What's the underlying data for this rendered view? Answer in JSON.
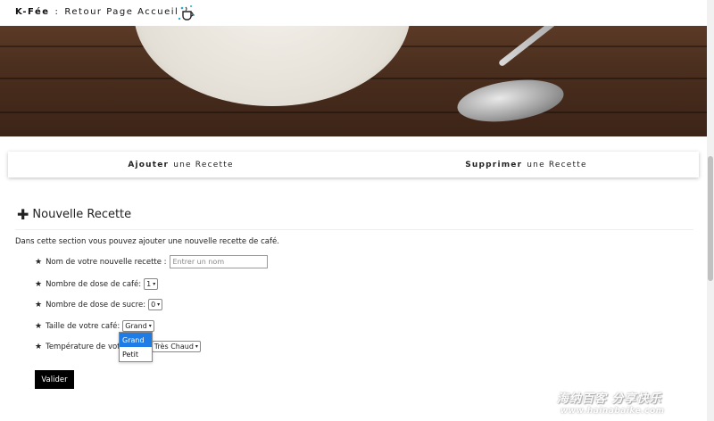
{
  "header": {
    "brand": "K-Fée",
    "separator": ":",
    "home_link": "Retour Page Accueil",
    "logo_icon": "coffee-cup-logo-icon"
  },
  "tabs": [
    {
      "bold": "Ajouter",
      "rest": "une Recette"
    },
    {
      "bold": "Supprimer",
      "rest": "une Recette"
    }
  ],
  "section": {
    "plus_icon": "plus-icon",
    "title": "Nouvelle Recette",
    "intro": "Dans cette section vous pouvez ajouter une nouvelle recette de café."
  },
  "form": {
    "name_label": "Nom de votre nouvelle recette :",
    "name_placeholder": "Entrer un nom",
    "coffee_dose_label": "Nombre de dose de café:",
    "coffee_dose_value": "1",
    "sugar_dose_label": "Nombre de dose de sucre:",
    "sugar_dose_value": "0",
    "size_label": "Taille de votre café:",
    "size_value": "Grand",
    "size_options": [
      "Grand",
      "Petit"
    ],
    "temp_label": "Température de votre café:",
    "temp_value": "Très Chaud",
    "submit": "Valider"
  },
  "watermark": {
    "line1": "海纳百客 分享快乐",
    "line2": "www.hainabaike.com"
  }
}
